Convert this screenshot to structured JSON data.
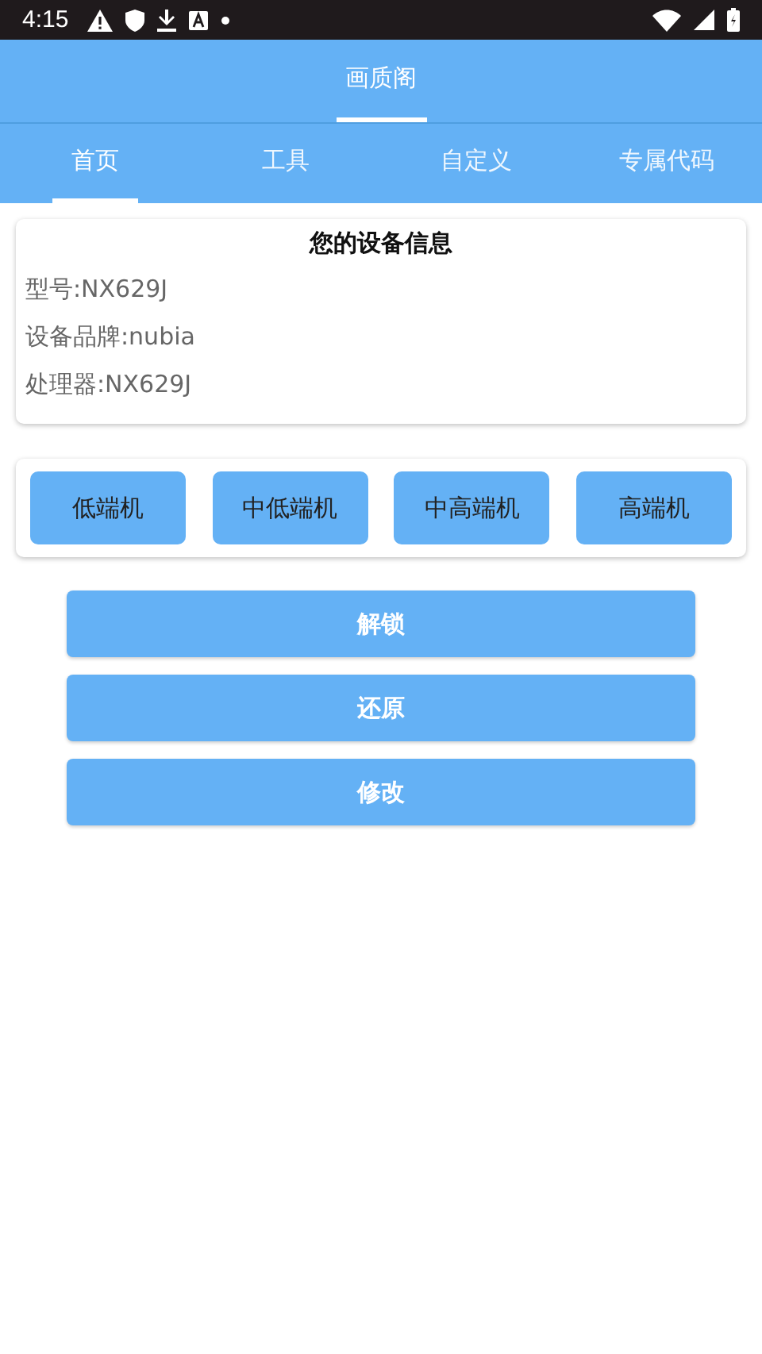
{
  "status_bar": {
    "time": "4:15"
  },
  "title_tabs": [
    {
      "label": "画质阁",
      "selected": true
    }
  ],
  "tabs": [
    {
      "label": "首页",
      "selected": true
    },
    {
      "label": "工具",
      "selected": false
    },
    {
      "label": "自定义",
      "selected": false
    },
    {
      "label": "专属代码",
      "selected": false
    }
  ],
  "device_info": {
    "title": "您的设备信息",
    "lines": [
      "型号:NX629J",
      "设备品牌:nubia",
      "处理器:NX629J"
    ]
  },
  "presets": [
    "低端机",
    "中低端机",
    "中高端机",
    "高端机"
  ],
  "actions": [
    "解锁",
    "还原",
    "修改"
  ]
}
